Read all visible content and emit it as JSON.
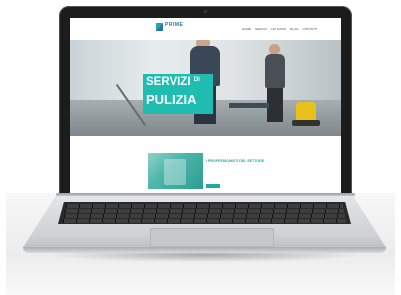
{
  "site": {
    "logo_text": "PRIME",
    "logo_sub": "",
    "nav": [
      "HOME",
      "SERVIZI",
      "CHI SIAMO",
      "BLOG",
      "CONTATTI"
    ],
    "hero": {
      "title_line1": "SERVIZI",
      "title_di": "DI",
      "title_line2": "PULIZIA",
      "description": "",
      "cta_label": ""
    },
    "section": {
      "kicker": "",
      "heading": "I PROFESSIONISTI DEL SETTORE",
      "text": ""
    }
  },
  "colors": {
    "accent": "#1fbdb1",
    "brand_blue": "#2d6fb5",
    "laptop_bezel": "#1c1c1c"
  }
}
